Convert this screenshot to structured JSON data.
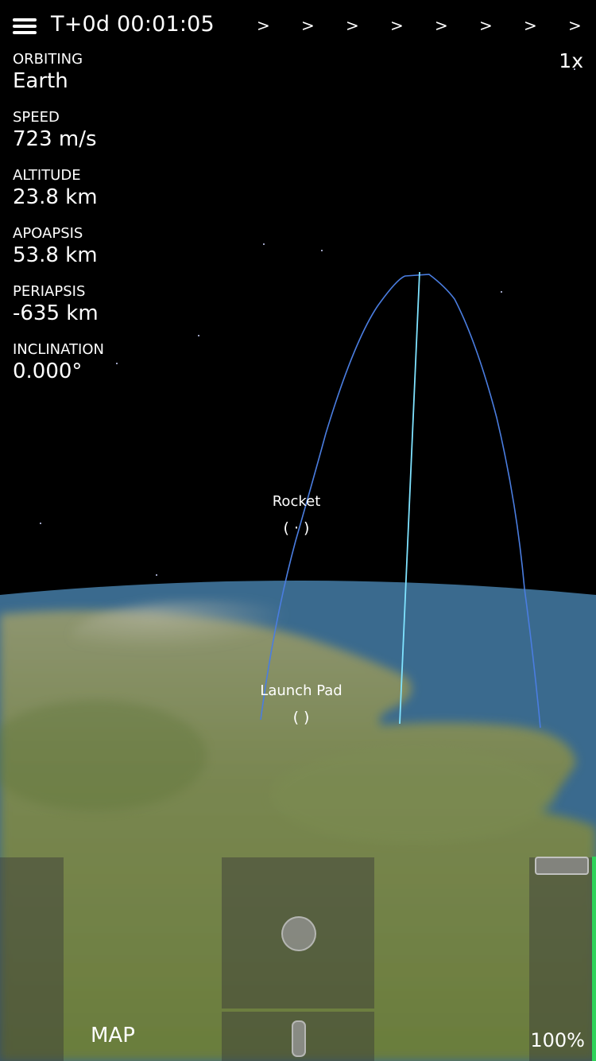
{
  "header": {
    "mission_time": "T+0d 00:01:05",
    "warp_arrows": [
      ">",
      ">",
      ">",
      ">",
      ">",
      ">",
      ">",
      ">"
    ],
    "timewarp": "1x"
  },
  "telemetry": [
    {
      "label": "ORBITING",
      "value": "Earth"
    },
    {
      "label": "SPEED",
      "value": "723 m/s"
    },
    {
      "label": "ALTITUDE",
      "value": "23.8 km"
    },
    {
      "label": "APOAPSIS",
      "value": "53.8 km"
    },
    {
      "label": "PERIAPSIS",
      "value": "-635 km"
    },
    {
      "label": "INCLINATION",
      "value": "0.000°"
    }
  ],
  "markers": {
    "rocket": {
      "label": "Rocket",
      "icon": "( · )"
    },
    "launch_pad": {
      "label": "Launch Pad",
      "icon": "( )"
    }
  },
  "controls": {
    "map_label": "MAP",
    "throttle_percent": 100,
    "throttle_text": "100%"
  },
  "colors": {
    "space": "#000000",
    "ocean": "#3a6a8e",
    "land": "#6f8248",
    "orbit_line": "#4a7de0",
    "trajectory_line": "#7fe3ff",
    "throttle": "#2fd35a"
  }
}
